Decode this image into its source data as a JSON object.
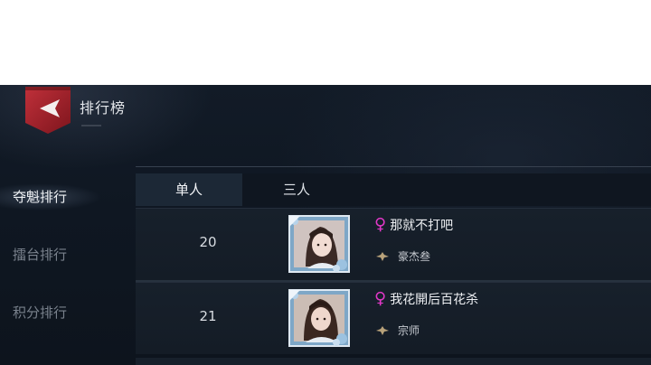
{
  "header": {
    "title": "排行榜",
    "back_icon": "back-arrow-icon",
    "accent_color": "#a4222a"
  },
  "sidebar": {
    "items": [
      {
        "label": "夺魁排行",
        "active": true
      },
      {
        "label": "擂台排行",
        "active": false
      },
      {
        "label": "积分排行",
        "active": false
      }
    ]
  },
  "tabs": [
    {
      "label": "单人",
      "active": true
    },
    {
      "label": "三人",
      "active": false
    }
  ],
  "rows": [
    {
      "rank": "20",
      "gender_symbol": "♀",
      "name": "那就不打吧",
      "title": "豪杰叁",
      "gender_color": "#e238c8"
    },
    {
      "rank": "21",
      "gender_symbol": "♀",
      "name": "我花開后百花杀",
      "title": "宗师",
      "gender_color": "#e238c8"
    }
  ]
}
